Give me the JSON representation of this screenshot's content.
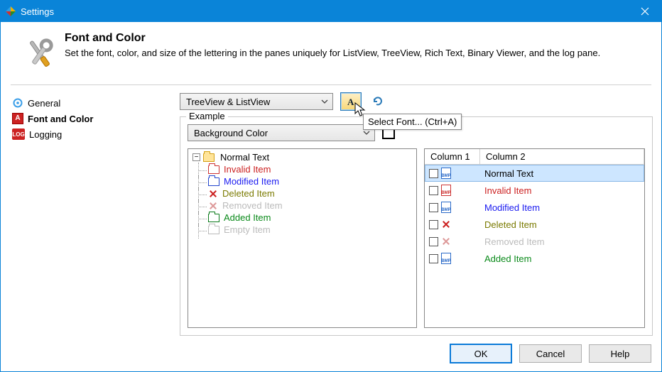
{
  "window": {
    "title": "Settings"
  },
  "header": {
    "title": "Font and Color",
    "subtitle": "Set the font, color, and size of the lettering in the panes uniquely for ListView, TreeView, Rich Text, Binary Viewer, and the log pane."
  },
  "sidebar": {
    "items": [
      {
        "label": "General"
      },
      {
        "label": "Font and Color"
      },
      {
        "label": "Logging"
      }
    ]
  },
  "main": {
    "view_combo": "TreeView & ListView",
    "font_button_tooltip": "Select Font... (Ctrl+A)",
    "example_legend": "Example",
    "bg_combo": "Background Color",
    "tree": {
      "root": "Normal Text",
      "items": [
        {
          "label": "Invalid Item",
          "color": "red",
          "icon": "folder-red"
        },
        {
          "label": "Modified Item",
          "color": "blue",
          "icon": "folder-blue"
        },
        {
          "label": "Deleted Item",
          "color": "olive",
          "icon": "x"
        },
        {
          "label": "Removed Item",
          "color": "gray",
          "icon": "x-faded"
        },
        {
          "label": "Added Item",
          "color": "green",
          "icon": "folder-green"
        },
        {
          "label": "Empty Item",
          "color": "gray",
          "icon": "folder-gray"
        }
      ]
    },
    "table": {
      "columns": [
        "Column 1",
        "Column 2"
      ],
      "rows": [
        {
          "label": "Normal Text",
          "color": "",
          "icon": "doc",
          "selected": true
        },
        {
          "label": "Invalid Item",
          "color": "red",
          "icon": "doc-red"
        },
        {
          "label": "Modified Item",
          "color": "blue",
          "icon": "doc"
        },
        {
          "label": "Deleted Item",
          "color": "olive",
          "icon": "doc-x"
        },
        {
          "label": "Removed Item",
          "color": "gray",
          "icon": "doc-x-faded"
        },
        {
          "label": "Added Item",
          "color": "green",
          "icon": "doc"
        }
      ]
    }
  },
  "buttons": {
    "ok": "OK",
    "cancel": "Cancel",
    "help": "Help"
  }
}
